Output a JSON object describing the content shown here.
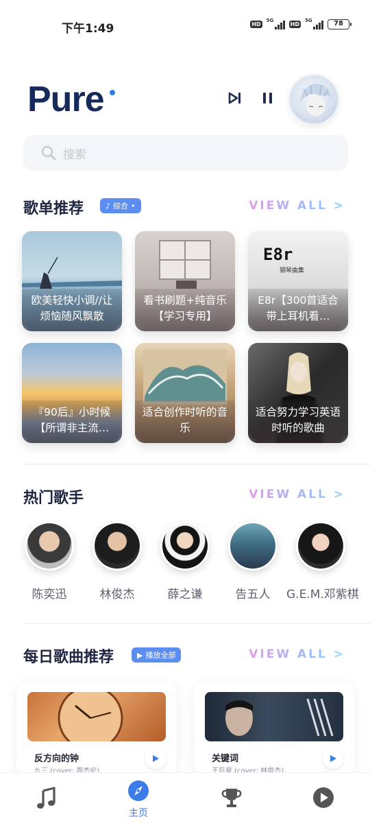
{
  "status_bar": {
    "time": "下午1:49",
    "hd1": "HD",
    "net1": "5G",
    "hd2": "HD",
    "net2": "5G",
    "battery": "78"
  },
  "header": {
    "logo": "Pure",
    "accent_color": "#2f7de8",
    "brand_color": "#162a5c"
  },
  "search": {
    "placeholder": "搜索"
  },
  "playlists": {
    "title": "歌单推荐",
    "chip": "综合",
    "view_all": "VIEW ALL >",
    "items": [
      {
        "label": "欧美轻快小调//让烦恼随风飘散"
      },
      {
        "label": "看书刷题+纯音乐【学习专用】"
      },
      {
        "label": "E8r【300首适合带上耳机看…"
      },
      {
        "label": "『90后』小时候【所谓非主流…"
      },
      {
        "label": "适合创作时听的音乐"
      },
      {
        "label": "适合努力学习英语时听的歌曲"
      }
    ],
    "cover3_title": "E8r",
    "cover3_subtitle": "钢琴曲集"
  },
  "artists": {
    "title": "热门歌手",
    "view_all": "VIEW ALL >",
    "items": [
      {
        "name": "陈奕迅"
      },
      {
        "name": "林俊杰"
      },
      {
        "name": "薛之谦"
      },
      {
        "name": "告五人"
      },
      {
        "name": "G.E.M.邓紫棋"
      }
    ]
  },
  "daily": {
    "title": "每日歌曲推荐",
    "chip": "播放全部",
    "view_all": "VIEW ALL >",
    "songs": [
      {
        "title": "反方向的钟",
        "subtitle": "九三 (cover: 周杰伦)"
      },
      {
        "title": "关键词",
        "subtitle": "王巨星 (cover: 林俊杰)"
      }
    ]
  },
  "bottom_nav": {
    "items": [
      {
        "icon": "music-note-icon",
        "label": ""
      },
      {
        "icon": "compass-icon",
        "label": "主页"
      },
      {
        "icon": "trophy-icon",
        "label": ""
      },
      {
        "icon": "play-circle-icon",
        "label": ""
      }
    ]
  }
}
